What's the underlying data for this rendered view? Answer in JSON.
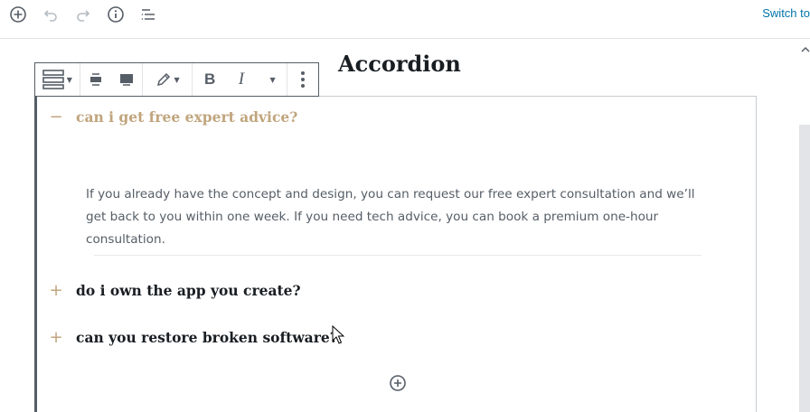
{
  "header": {
    "switch_label": "Switch to"
  },
  "icons": {
    "add": "plus-circle-icon",
    "undo": "undo-icon",
    "redo": "redo-icon",
    "info": "info-icon",
    "outline": "list-outline-icon"
  },
  "block_toolbar": {
    "bold_label": "B",
    "italic_label": "I"
  },
  "page": {
    "title": "Accordion"
  },
  "accordion": {
    "items": [
      {
        "sign": "−",
        "question": "can i get free expert advice?",
        "answer": "If you already have the concept and design, you can request our free expert consultation and we’ll get back to you within one week. If you need tech advice, you can book a premium one-hour consultation."
      },
      {
        "sign": "+",
        "question": "do i own the app you create?"
      },
      {
        "sign": "+",
        "question": "can you restore broken software?"
      }
    ]
  },
  "colors": {
    "accent": "#c0a57d",
    "link": "#0073aa",
    "text": "#191e23",
    "muted": "#555d66"
  }
}
